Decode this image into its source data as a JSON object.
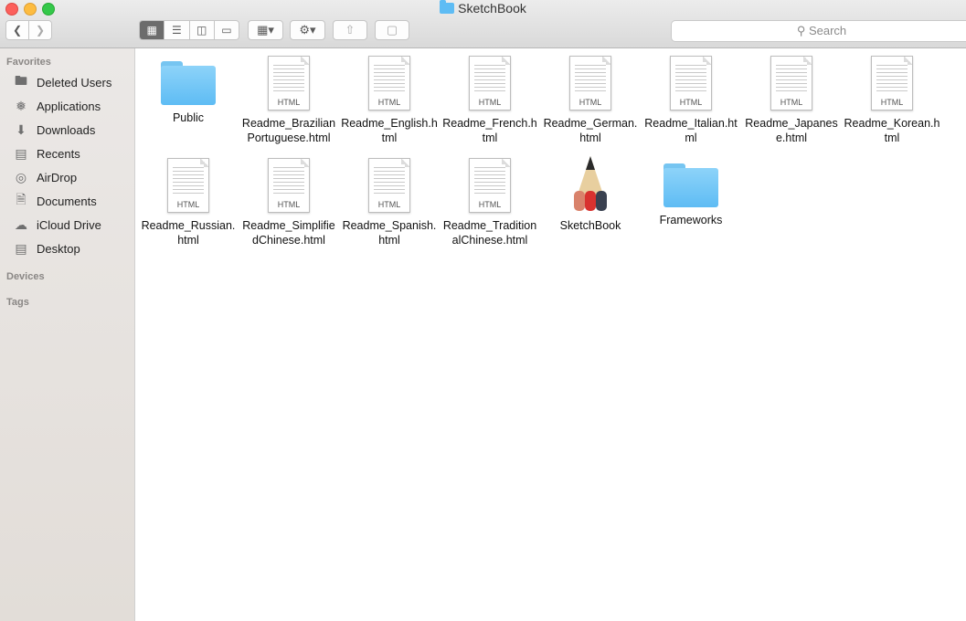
{
  "window": {
    "title": "SketchBook"
  },
  "toolbar": {
    "back_icon": "chevron-left-icon",
    "forward_icon": "chevron-right-icon",
    "view_modes": [
      "icon-view",
      "list-view",
      "column-view",
      "gallery-view"
    ],
    "active_view": "icon-view",
    "group_icon": "arrange-icon",
    "action_icon": "gear-icon",
    "share_icon": "share-icon",
    "tag_icon": "tag-icon",
    "search_placeholder": "Search"
  },
  "sidebar": {
    "favorites_header": "Favorites",
    "items": [
      {
        "label": "Deleted Users",
        "icon": "folder-icon"
      },
      {
        "label": "Applications",
        "icon": "applications-icon"
      },
      {
        "label": "Downloads",
        "icon": "downloads-icon"
      },
      {
        "label": "Recents",
        "icon": "recents-icon"
      },
      {
        "label": "AirDrop",
        "icon": "airdrop-icon"
      },
      {
        "label": "Documents",
        "icon": "documents-icon"
      },
      {
        "label": "iCloud Drive",
        "icon": "cloud-icon"
      },
      {
        "label": "Desktop",
        "icon": "desktop-icon"
      }
    ],
    "devices_header": "Devices",
    "tags_header": "Tags"
  },
  "files": [
    {
      "name": "Public",
      "kind": "folder"
    },
    {
      "name": "Readme_Brazilian\nPortuguese.html",
      "kind": "HTML"
    },
    {
      "name": "Readme_English.h\ntml",
      "kind": "HTML"
    },
    {
      "name": "Readme_French.h\ntml",
      "kind": "HTML"
    },
    {
      "name": "Readme_German.\nhtml",
      "kind": "HTML"
    },
    {
      "name": "Readme_Italian.ht\nml",
      "kind": "HTML"
    },
    {
      "name": "Readme_Japanes\ne.html",
      "kind": "HTML"
    },
    {
      "name": "Readme_Korean.h\ntml",
      "kind": "HTML"
    },
    {
      "name": "Readme_Russian.\nhtml",
      "kind": "HTML"
    },
    {
      "name": "Readme_Simplifie\ndChinese.html",
      "kind": "HTML"
    },
    {
      "name": "Readme_Spanish.\nhtml",
      "kind": "HTML"
    },
    {
      "name": "Readme_Tradition\nalChinese.html",
      "kind": "HTML"
    },
    {
      "name": "SketchBook",
      "kind": "app"
    },
    {
      "name": "Frameworks",
      "kind": "folder"
    }
  ]
}
